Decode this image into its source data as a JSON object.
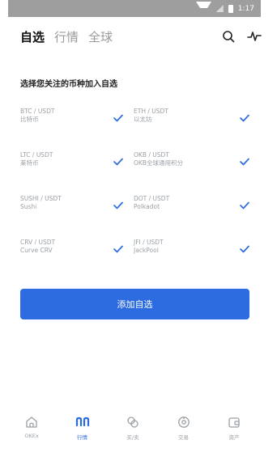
{
  "status_bar": {
    "time": "1:17"
  },
  "header": {
    "tabs": [
      {
        "label": "自选",
        "active": true
      },
      {
        "label": "行情",
        "active": false
      },
      {
        "label": "全球",
        "active": false
      }
    ],
    "icons": [
      "search-icon",
      "activity-icon"
    ]
  },
  "section_title": "选择您关注的币种加入自选",
  "coins": [
    {
      "pair": "BTC / USDT",
      "name": "比特币",
      "checked": true
    },
    {
      "pair": "ETH / USDT",
      "name": "以太坊",
      "checked": true
    },
    {
      "pair": "LTC / USDT",
      "name": "莱特币",
      "checked": true
    },
    {
      "pair": "OKB / USDT",
      "name": "OKB全球通用积分",
      "checked": true
    },
    {
      "pair": "SUSHI / USDT",
      "name": "Sushi",
      "checked": true
    },
    {
      "pair": "DOT / USDT",
      "name": "Polkadot",
      "checked": true
    },
    {
      "pair": "CRV / USDT",
      "name": "Curve CRV",
      "checked": true
    },
    {
      "pair": "JFI / USDT",
      "name": "JackPool",
      "checked": true
    }
  ],
  "add_button": {
    "label": "添加自选"
  },
  "bottom_nav": [
    {
      "label": "OKEx",
      "icon": "home-icon",
      "active": false
    },
    {
      "label": "行情",
      "icon": "market-icon",
      "active": true
    },
    {
      "label": "买/卖",
      "icon": "trade-icon",
      "active": false
    },
    {
      "label": "交易",
      "icon": "exchange-icon",
      "active": false
    },
    {
      "label": "资产",
      "icon": "wallet-icon",
      "active": false
    }
  ],
  "colors": {
    "accent": "#2c6be0",
    "muted": "#9aa0a6",
    "status_bar": "#9e9e9e"
  }
}
